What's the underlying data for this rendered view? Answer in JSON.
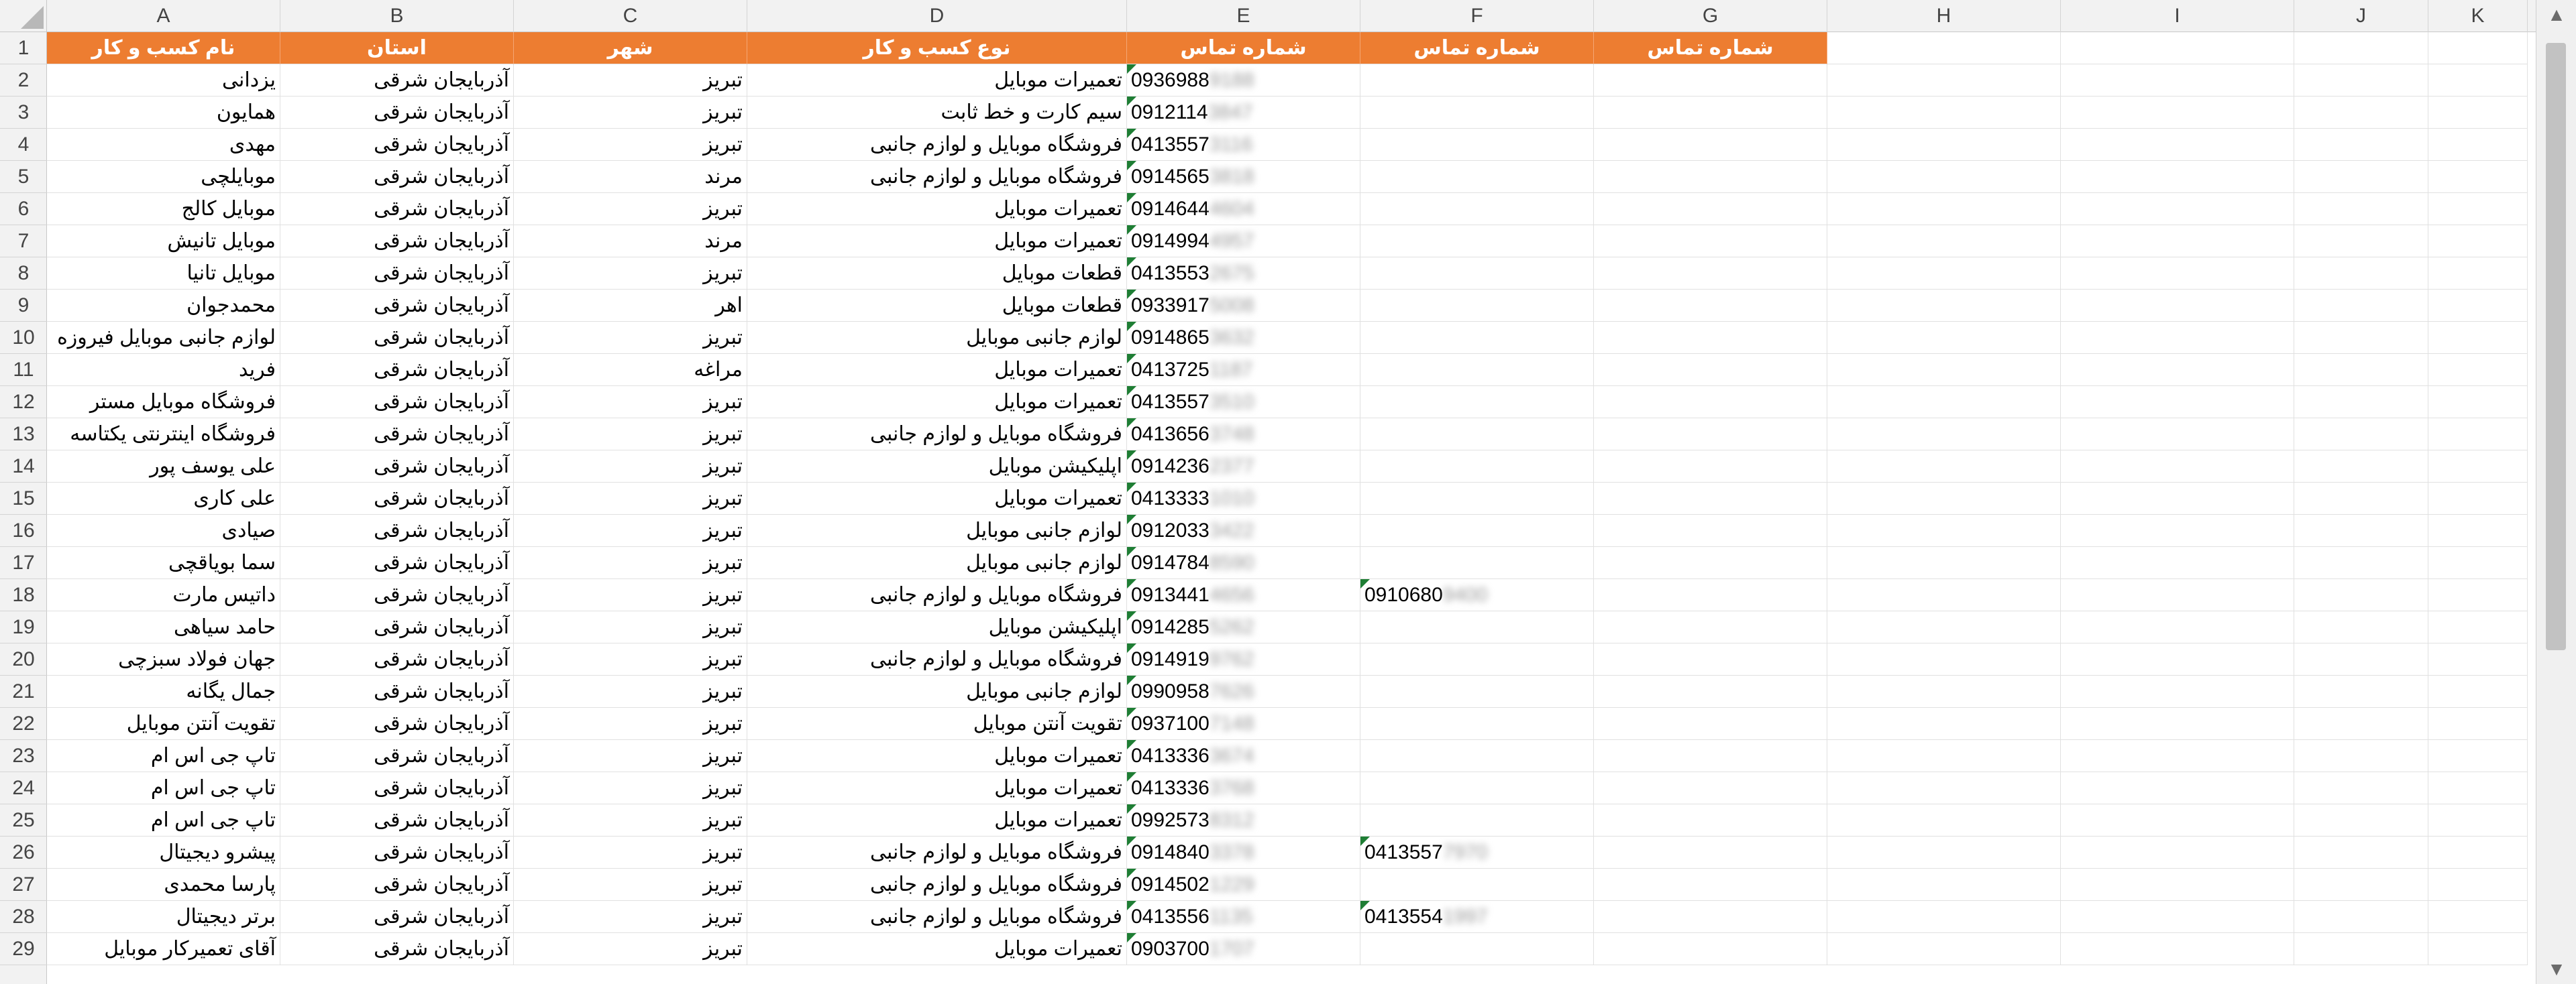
{
  "columns": [
    "A",
    "B",
    "C",
    "D",
    "E",
    "F",
    "G",
    "H",
    "I",
    "J",
    "K"
  ],
  "header_row": [
    "نام کسب و کار",
    "استان",
    "شهر",
    "نوع کسب و کار",
    "شماره تماس",
    "شماره تماس",
    "شماره تماس"
  ],
  "rows": [
    {
      "name": "یزدانی",
      "province": "آذربایجان شرقی",
      "city": "تبریز",
      "type": "تعمیرات موبایل",
      "phone": "0936988",
      "phone_hidden": "9188",
      "phone2": "",
      "phone2_hidden": ""
    },
    {
      "name": "همایون",
      "province": "آذربایجان شرقی",
      "city": "تبریز",
      "type": "سیم کارت و خط ثابت",
      "phone": "0912114",
      "phone_hidden": "3847",
      "phone2": "",
      "phone2_hidden": ""
    },
    {
      "name": "مهدی",
      "province": "آذربایجان شرقی",
      "city": "تبریز",
      "type": "فروشگاه موبایل و لوازم جانبی",
      "phone": "0413557",
      "phone_hidden": "3116",
      "phone2": "",
      "phone2_hidden": ""
    },
    {
      "name": "موبایلچی",
      "province": "آذربایجان شرقی",
      "city": "مرند",
      "type": "فروشگاه موبایل و لوازم جانبی",
      "phone": "0914565",
      "phone_hidden": "3818",
      "phone2": "",
      "phone2_hidden": ""
    },
    {
      "name": "موبایل کالج",
      "province": "آذربایجان شرقی",
      "city": "تبریز",
      "type": "تعمیرات موبایل",
      "phone": "0914644",
      "phone_hidden": "4604",
      "phone2": "",
      "phone2_hidden": ""
    },
    {
      "name": "موبایل تانیش",
      "province": "آذربایجان شرقی",
      "city": "مرند",
      "type": "تعمیرات موبایل",
      "phone": "0914994",
      "phone_hidden": "4957",
      "phone2": "",
      "phone2_hidden": ""
    },
    {
      "name": "موبایل تانیا",
      "province": "آذربایجان شرقی",
      "city": "تبریز",
      "type": "قطعات موبایل",
      "phone": "0413553",
      "phone_hidden": "2675",
      "phone2": "",
      "phone2_hidden": ""
    },
    {
      "name": "محمدجوان",
      "province": "آذربایجان شرقی",
      "city": "اهر",
      "type": "قطعات موبایل",
      "phone": "0933917",
      "phone_hidden": "5008",
      "phone2": "",
      "phone2_hidden": ""
    },
    {
      "name": "لوازم جانبی موبایل فیروزه",
      "province": "آذربایجان شرقی",
      "city": "تبریز",
      "type": "لوازم جانبی موبایل",
      "phone": "0914865",
      "phone_hidden": "3632",
      "phone2": "",
      "phone2_hidden": ""
    },
    {
      "name": "فرید",
      "province": "آذربایجان شرقی",
      "city": "مراغه",
      "type": "تعمیرات موبایل",
      "phone": "0413725",
      "phone_hidden": "1187",
      "phone2": "",
      "phone2_hidden": ""
    },
    {
      "name": "فروشگاه موبایل مستر",
      "province": "آذربایجان شرقی",
      "city": "تبریز",
      "type": "تعمیرات موبایل",
      "phone": "0413557",
      "phone_hidden": "3510",
      "phone2": "",
      "phone2_hidden": ""
    },
    {
      "name": "فروشگاه اینترنتی یکتاسه",
      "province": "آذربایجان شرقی",
      "city": "تبریز",
      "type": "فروشگاه موبایل و لوازم جانبی",
      "phone": "0413656",
      "phone_hidden": "3748",
      "phone2": "",
      "phone2_hidden": ""
    },
    {
      "name": "علی یوسف پور",
      "province": "آذربایجان شرقی",
      "city": "تبریز",
      "type": "اپلیکیشن موبایل",
      "phone": "0914236",
      "phone_hidden": "2377",
      "phone2": "",
      "phone2_hidden": ""
    },
    {
      "name": "علی کاری",
      "province": "آذربایجان شرقی",
      "city": "تبریز",
      "type": "تعمیرات موبایل",
      "phone": "0413333",
      "phone_hidden": "1010",
      "phone2": "",
      "phone2_hidden": ""
    },
    {
      "name": "صیادی",
      "province": "آذربایجان شرقی",
      "city": "تبریز",
      "type": "لوازم جانبی موبایل",
      "phone": "0912033",
      "phone_hidden": "3422",
      "phone2": "",
      "phone2_hidden": ""
    },
    {
      "name": "سما بویاقچی",
      "province": "آذربایجان شرقی",
      "city": "تبریز",
      "type": "لوازم جانبی موبایل",
      "phone": "0914784",
      "phone_hidden": "8590",
      "phone2": "",
      "phone2_hidden": ""
    },
    {
      "name": "داتیس مارت",
      "province": "آذربایجان شرقی",
      "city": "تبریز",
      "type": "فروشگاه موبایل و لوازم جانبی",
      "phone": "0913441",
      "phone_hidden": "4656",
      "phone2": "0910680",
      "phone2_hidden": "9400"
    },
    {
      "name": "حامد سیاهی",
      "province": "آذربایجان شرقی",
      "city": "تبریز",
      "type": "اپلیکیشن موبایل",
      "phone": "0914285",
      "phone_hidden": "5262",
      "phone2": "",
      "phone2_hidden": ""
    },
    {
      "name": "جهان فولاد سبزچی",
      "province": "آذربایجان شرقی",
      "city": "تبریز",
      "type": "فروشگاه موبایل و لوازم جانبی",
      "phone": "0914919",
      "phone_hidden": "9762",
      "phone2": "",
      "phone2_hidden": ""
    },
    {
      "name": "جمال یگانه",
      "province": "آذربایجان شرقی",
      "city": "تبریز",
      "type": "لوازم جانبی موبایل",
      "phone": "0990958",
      "phone_hidden": "7626",
      "phone2": "",
      "phone2_hidden": ""
    },
    {
      "name": "تقویت آنتن موبایل",
      "province": "آذربایجان شرقی",
      "city": "تبریز",
      "type": "تقویت آنتن موبایل",
      "phone": "0937100",
      "phone_hidden": "7148",
      "phone2": "",
      "phone2_hidden": ""
    },
    {
      "name": "تاپ جی اس ام",
      "province": "آذربایجان شرقی",
      "city": "تبریز",
      "type": "تعمیرات موبایل",
      "phone": "0413336",
      "phone_hidden": "3674",
      "phone2": "",
      "phone2_hidden": ""
    },
    {
      "name": "تاپ جی اس ام",
      "province": "آذربایجان شرقی",
      "city": "تبریز",
      "type": "تعمیرات موبایل",
      "phone": "0413336",
      "phone_hidden": "3768",
      "phone2": "",
      "phone2_hidden": ""
    },
    {
      "name": "تاپ جی اس ام",
      "province": "آذربایجان شرقی",
      "city": "تبریز",
      "type": "تعمیرات موبایل",
      "phone": "0992573",
      "phone_hidden": "8312",
      "phone2": "",
      "phone2_hidden": ""
    },
    {
      "name": "پیشرو دیجیتال",
      "province": "آذربایجان شرقی",
      "city": "تبریز",
      "type": "فروشگاه موبایل و لوازم جانبی",
      "phone": "0914840",
      "phone_hidden": "3378",
      "phone2": "0413557",
      "phone2_hidden": "7970"
    },
    {
      "name": "پارسا محمدی",
      "province": "آذربایجان شرقی",
      "city": "تبریز",
      "type": "فروشگاه موبایل و لوازم جانبی",
      "phone": "0914502",
      "phone_hidden": "1229",
      "phone2": "",
      "phone2_hidden": ""
    },
    {
      "name": "برتر دیجیتال",
      "province": "آذربایجان شرقی",
      "city": "تبریز",
      "type": "فروشگاه موبایل و لوازم جانبی",
      "phone": "0413556",
      "phone_hidden": "1135",
      "phone2": "0413554",
      "phone2_hidden": "1997"
    },
    {
      "name": "آقای تعمیرکار موبایل",
      "province": "آذربایجان شرقی",
      "city": "تبریز",
      "type": "تعمیرات موبایل",
      "phone": "0903700",
      "phone_hidden": "1707",
      "phone2": "",
      "phone2_hidden": ""
    }
  ],
  "scrollbar": {
    "up_arrow": "▲",
    "down_arrow": "▼"
  },
  "colors": {
    "header_fill": "#ed7d31",
    "header_text": "#ffffff",
    "number_as_text_flag": "#1e7e34"
  }
}
